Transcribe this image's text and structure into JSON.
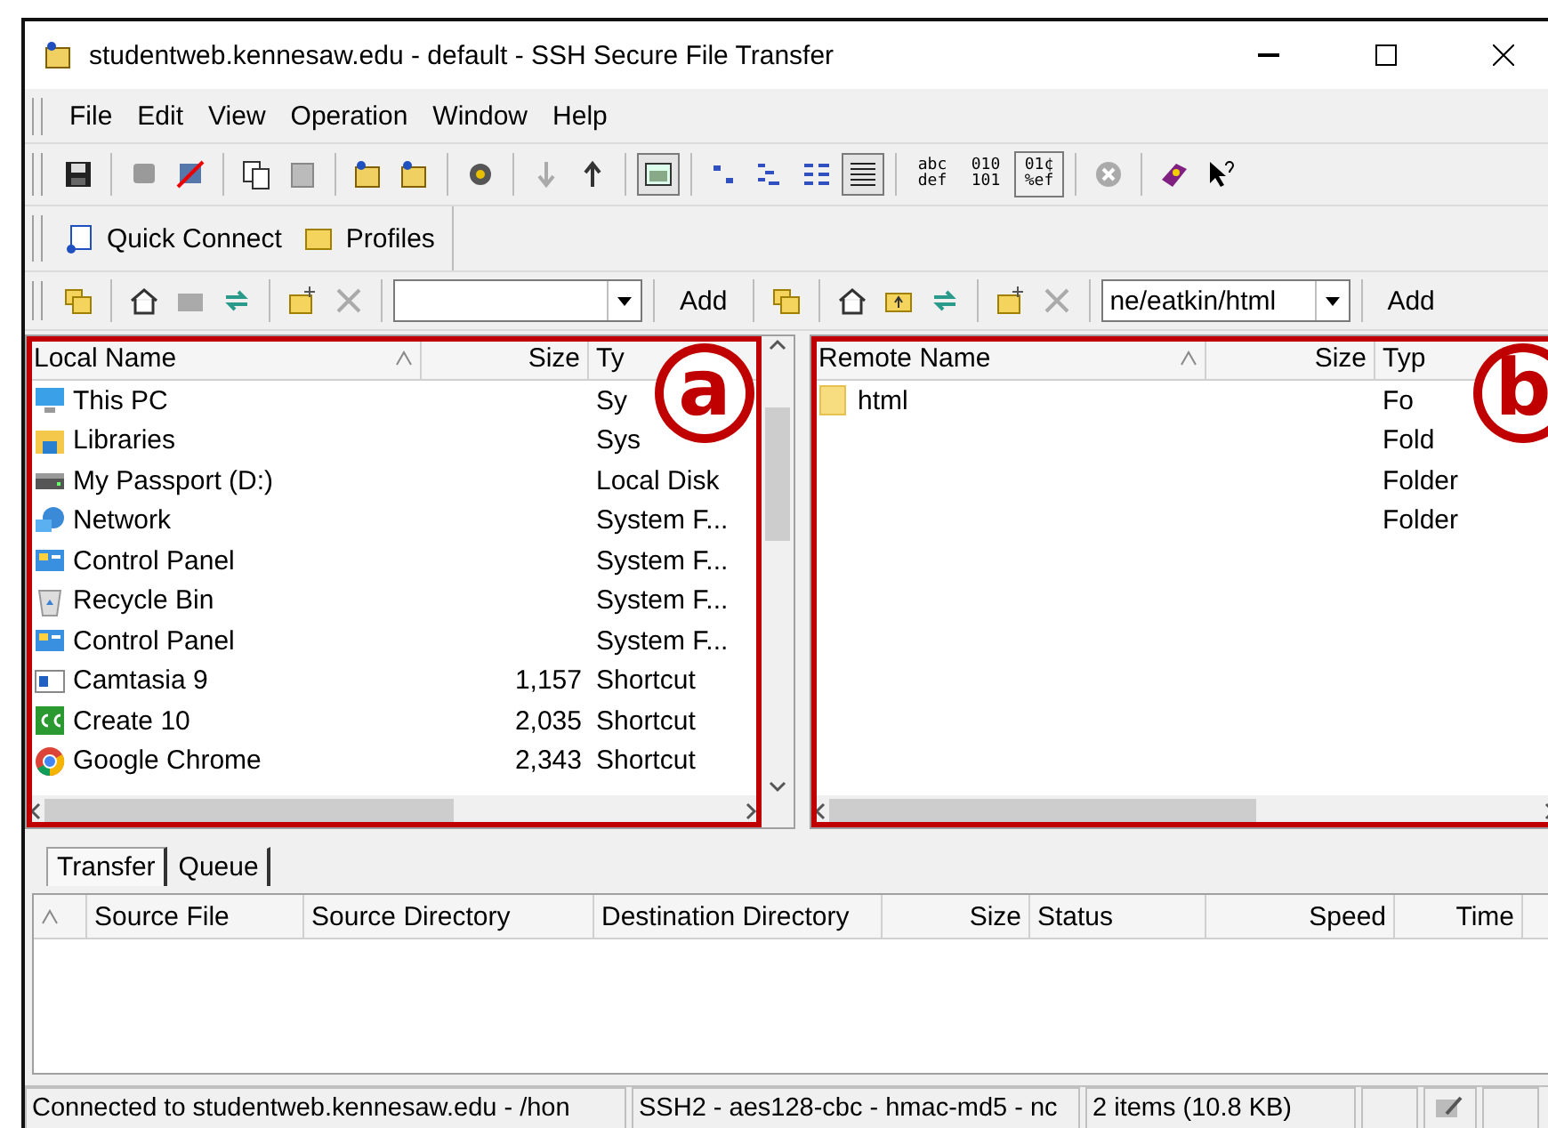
{
  "window": {
    "title": "studentweb.kennesaw.edu - default - SSH Secure File Transfer"
  },
  "menu": [
    "File",
    "Edit",
    "View",
    "Operation",
    "Window",
    "Help"
  ],
  "toolbar": {
    "layout_toggle": {
      "on": true
    },
    "view_modes": [
      {
        "selected": false
      },
      {
        "selected": false
      },
      {
        "selected": false
      },
      {
        "selected": true
      }
    ],
    "format_buttons": [
      {
        "label": "abc def",
        "selected": false
      },
      {
        "label": "010 101",
        "selected": false
      },
      {
        "label": "01¢ %ef",
        "selected": true
      }
    ]
  },
  "profile_bar": [
    {
      "label": "Quick Connect",
      "kind": "connect"
    },
    {
      "label": "Profiles",
      "kind": "folder"
    }
  ],
  "local": {
    "add": "Add",
    "columns": [
      "Local Name",
      "Size",
      "Ty"
    ],
    "rows": [
      {
        "kind": "pc",
        "name": "This PC",
        "size": "",
        "type": "Sy"
      },
      {
        "kind": "library",
        "name": "Libraries",
        "size": "",
        "type": "Sys"
      },
      {
        "kind": "drive",
        "name": "My Passport (D:)",
        "size": "",
        "type": "Local Disk"
      },
      {
        "kind": "network",
        "name": "Network",
        "size": "",
        "type": "System F..."
      },
      {
        "kind": "control",
        "name": "Control Panel",
        "size": "",
        "type": "System F..."
      },
      {
        "kind": "recycle",
        "name": "Recycle Bin",
        "size": "",
        "type": "System F..."
      },
      {
        "kind": "control",
        "name": "Control Panel",
        "size": "",
        "type": "System F..."
      },
      {
        "kind": "camtasia",
        "name": "Camtasia 9",
        "size": "1,157",
        "type": "Shortcut"
      },
      {
        "kind": "create",
        "name": "Create 10",
        "size": "2,035",
        "type": "Shortcut"
      },
      {
        "kind": "chrome",
        "name": "Google Chrome",
        "size": "2,343",
        "type": "Shortcut"
      }
    ],
    "callout": "a"
  },
  "remote": {
    "path": "ne/eatkin/html",
    "add": "Add",
    "columns": [
      "Remote Name",
      "Size",
      "Typ"
    ],
    "rows": [
      {
        "kind": "folder",
        "name": "html",
        "size": "",
        "type": "Fo"
      },
      {
        "kind": "none",
        "name": "",
        "size": "",
        "type": "Fold"
      },
      {
        "kind": "none",
        "name": "",
        "size": "",
        "type": "Folder"
      },
      {
        "kind": "none",
        "name": "",
        "size": "",
        "type": "Folder"
      }
    ],
    "callout": "b"
  },
  "transfer": {
    "tabs": [
      {
        "label": "Transfer",
        "selected": true
      },
      {
        "label": "Queue",
        "selected": false
      }
    ],
    "columns": [
      "Source File",
      "Source Directory",
      "Destination Directory",
      "Size",
      "Status",
      "Speed",
      "Time"
    ]
  },
  "status_bar": [
    "Connected to studentweb.kennesaw.edu - /hon",
    "SSH2 - aes128-cbc - hmac-md5 - nc",
    "2 items (10.8 KB)"
  ]
}
